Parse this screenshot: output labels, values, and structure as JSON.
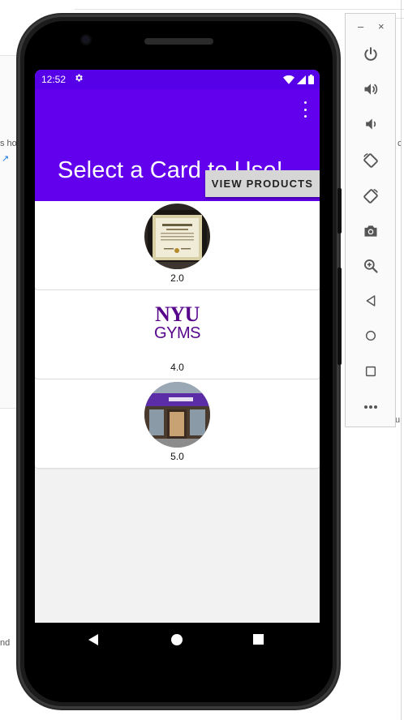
{
  "status_bar": {
    "time": "12:52",
    "settings_icon": "gear-icon",
    "wifi_icon": "wifi-icon",
    "signal_icon": "cell-signal-icon",
    "battery_icon": "battery-icon"
  },
  "app_bar": {
    "title": "Select a Card to Use!",
    "overflow_icon": "more-vert-icon",
    "background_color": "#6200ee",
    "status_color": "#5600e8"
  },
  "view_products_button": {
    "label": "VIEW PRODUCTS"
  },
  "cards": [
    {
      "image": "framed-certificate-image",
      "value": "2.0"
    },
    {
      "image": "nyu-gyms-logo",
      "logo_line1": "NYU",
      "logo_line2": "GYMS",
      "value": "4.0"
    },
    {
      "image": "nyu-bookstore-storefront-image",
      "value": "5.0"
    }
  ],
  "nav_bar": {
    "back_icon": "back-triangle-icon",
    "home_icon": "home-circle-icon",
    "recents_icon": "recents-square-icon"
  },
  "emulator_toolbar": {
    "minimize": "–",
    "close": "×",
    "buttons": [
      "power-icon",
      "volume-up-icon",
      "volume-down-icon",
      "rotate-left-icon",
      "rotate-right-icon",
      "camera-icon",
      "zoom-icon",
      "back-icon",
      "home-icon",
      "overview-icon",
      "more-icon"
    ]
  },
  "background_fragments": {
    "left_text": "s ho",
    "left_text_bottom": "nd",
    "right_text": "c",
    "right_text_bottom": "u"
  }
}
